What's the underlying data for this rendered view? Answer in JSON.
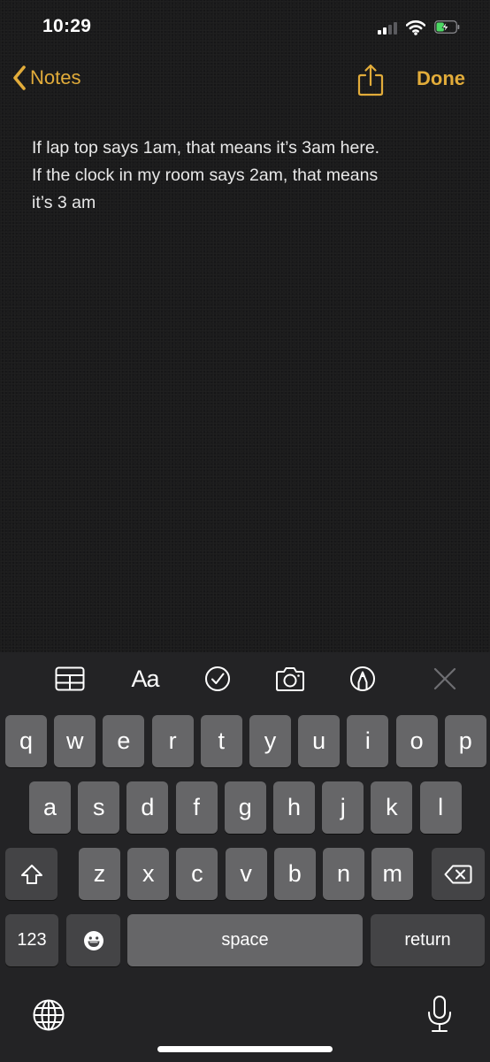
{
  "status_bar": {
    "time": "10:29",
    "signal_bars_active": 2,
    "signal_bars_total": 4,
    "battery_level": 0.4,
    "battery_charging": true,
    "battery_color": "#4cd964"
  },
  "nav": {
    "back_label": "Notes",
    "done_label": "Done",
    "accent_color": "#e2ac3a"
  },
  "note": {
    "lines": [
      "If lap top says 1am, that means it’s 3am here.",
      "If the clock in my room says 2am, that means",
      "it’s 3 am"
    ]
  },
  "toolbar": {
    "items": [
      {
        "icon": "table-icon"
      },
      {
        "icon": "text-format-icon",
        "label": "Aa"
      },
      {
        "icon": "checklist-icon"
      },
      {
        "icon": "camera-icon"
      },
      {
        "icon": "markup-pen-icon"
      },
      {
        "icon": "close-icon"
      }
    ]
  },
  "keyboard": {
    "row1": [
      "q",
      "w",
      "e",
      "r",
      "t",
      "y",
      "u",
      "i",
      "o",
      "p"
    ],
    "row2": [
      "a",
      "s",
      "d",
      "f",
      "g",
      "h",
      "j",
      "k",
      "l"
    ],
    "row3": [
      "z",
      "x",
      "c",
      "v",
      "b",
      "n",
      "m"
    ],
    "numbers_label": "123",
    "space_label": "space",
    "return_label": "return"
  }
}
